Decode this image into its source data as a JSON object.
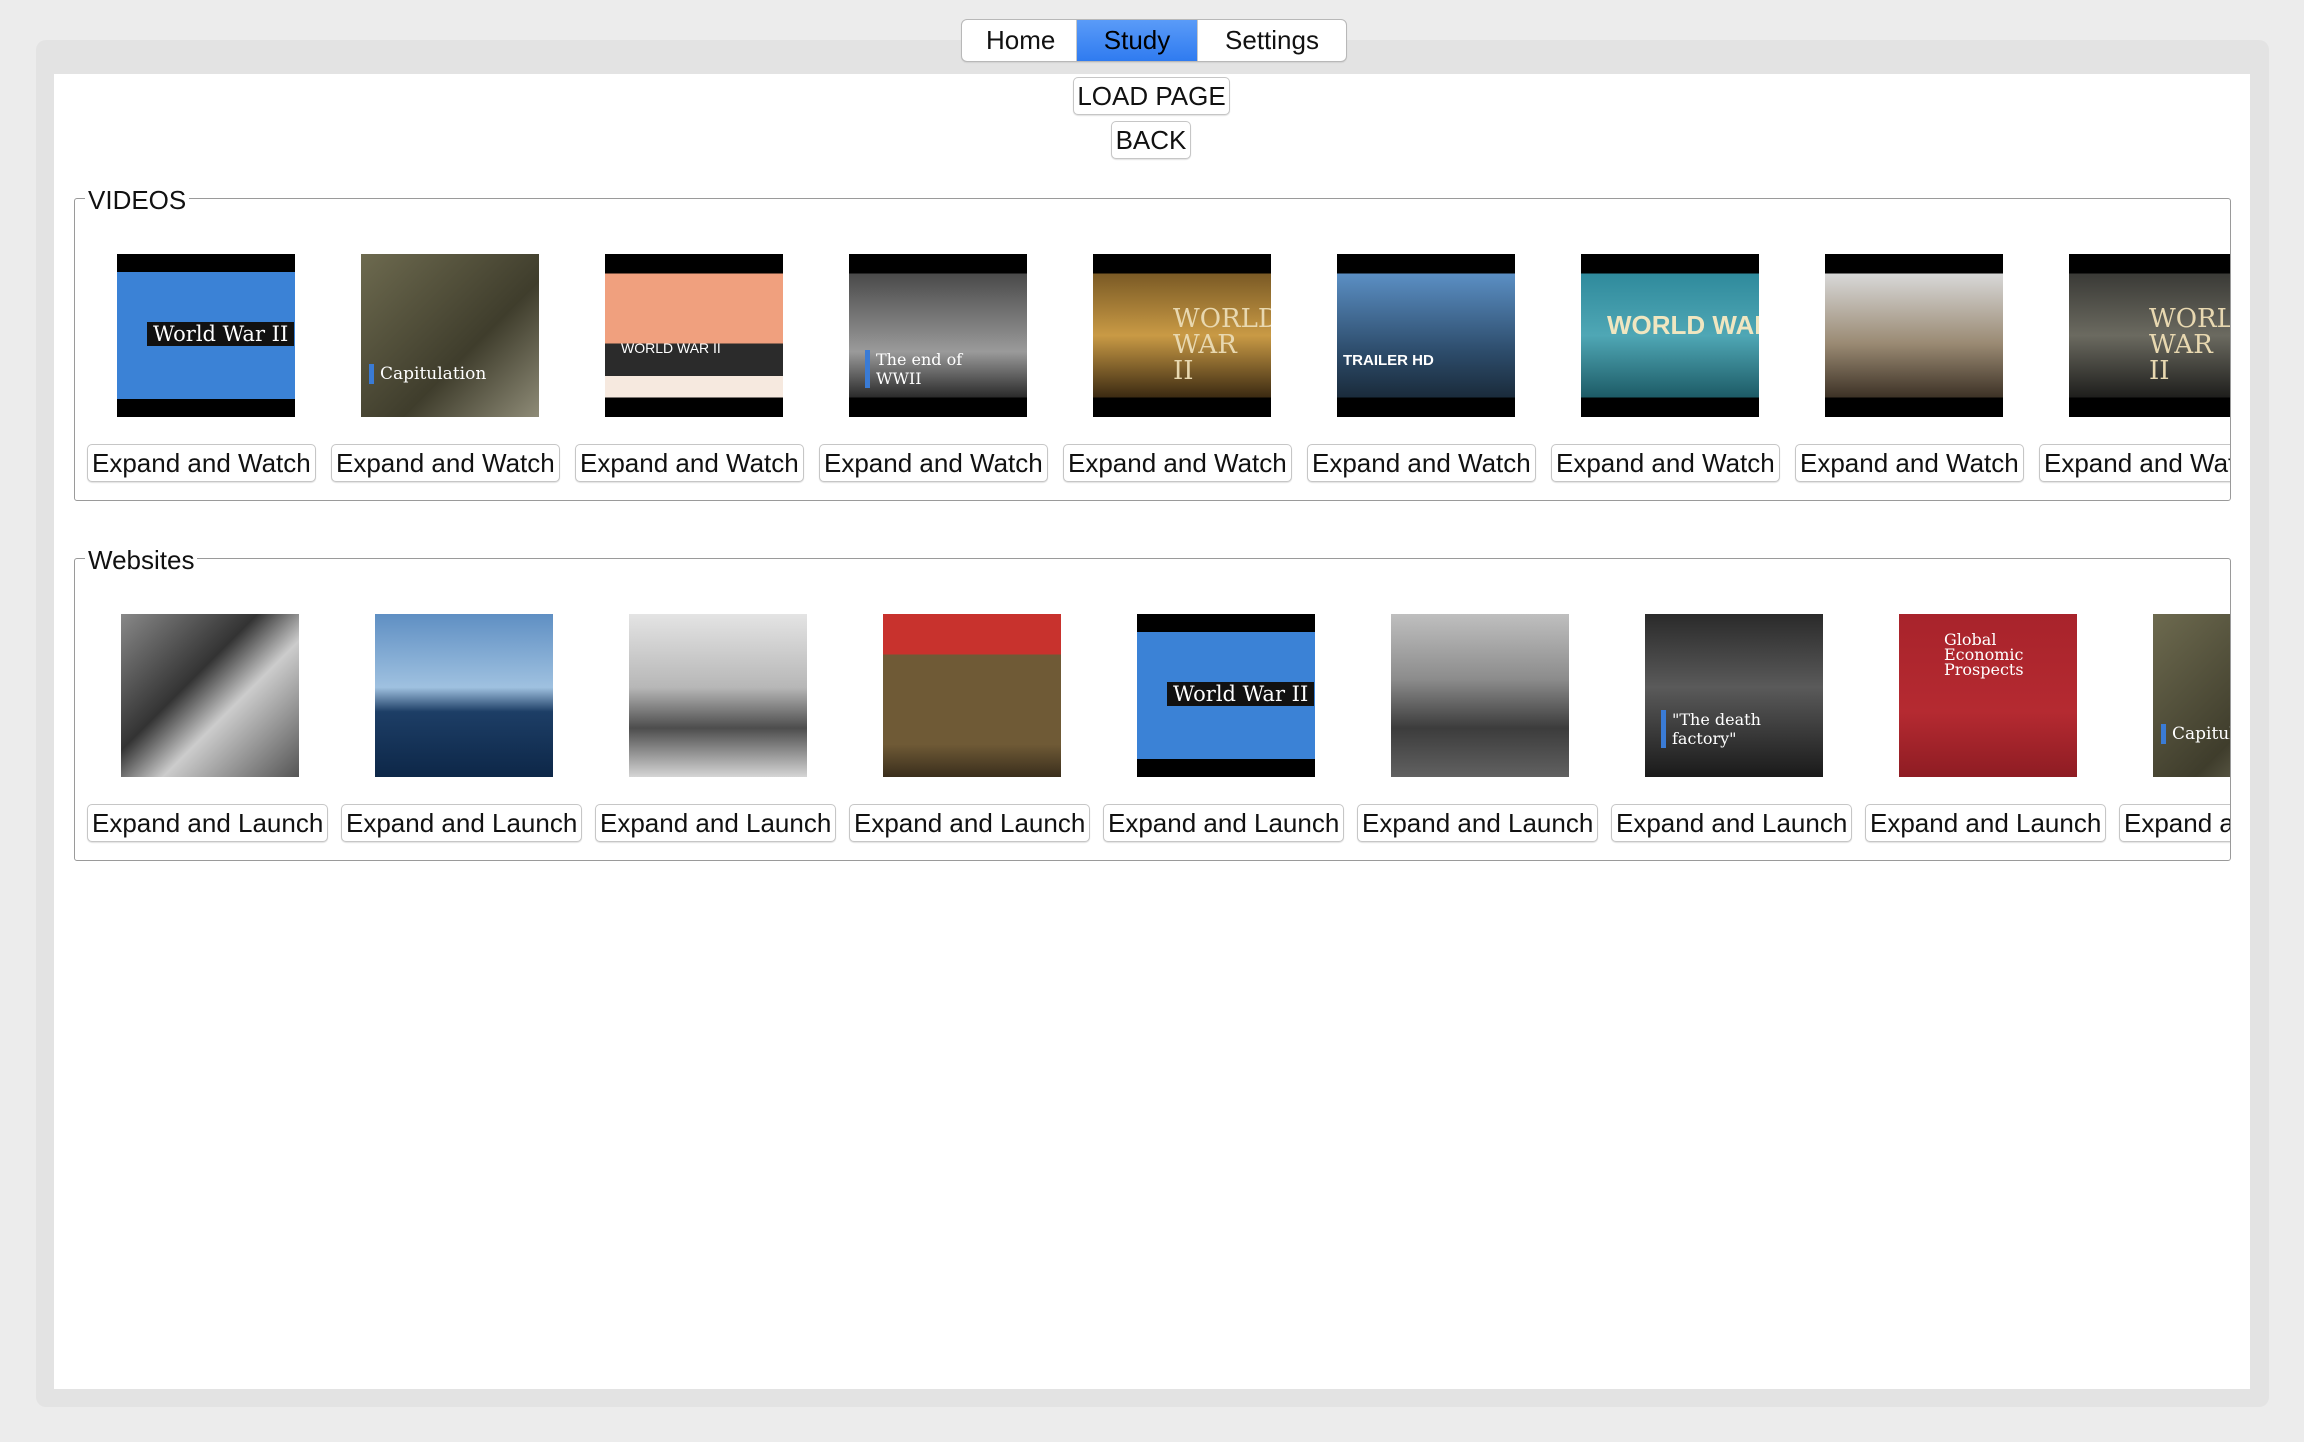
{
  "tabs": [
    {
      "label": "Home",
      "active": false
    },
    {
      "label": "Study",
      "active": true
    },
    {
      "label": "Settings",
      "active": false
    }
  ],
  "actions": {
    "load_label": "LOAD PAGE",
    "back_label": "BACK"
  },
  "videos": {
    "title": "VIDEOS",
    "button_label": "Expand and Watch",
    "items": [
      {
        "caption": "World War II",
        "theme": "map-blue"
      },
      {
        "caption": "Capitulation",
        "theme": "soldiers"
      },
      {
        "caption": "WORLD WAR II",
        "theme": "peach-figures"
      },
      {
        "caption": "The end of WWII",
        "theme": "helmet-bw"
      },
      {
        "caption": "WORLD WAR II",
        "theme": "gold-silhouette"
      },
      {
        "caption": "TRAILER HD",
        "theme": "helmet-color"
      },
      {
        "caption": "WORLD WAR II",
        "theme": "cartoon-teal"
      },
      {
        "caption": "",
        "theme": "salute"
      },
      {
        "caption": "WORLD WAR II",
        "theme": "dark-painting"
      }
    ]
  },
  "websites": {
    "title": "Websites",
    "button_label": "Expand and Launch",
    "items": [
      {
        "caption": "",
        "theme": "collage-bw"
      },
      {
        "caption": "",
        "theme": "plane-sky"
      },
      {
        "caption": "",
        "theme": "tanks-bw"
      },
      {
        "caption": "",
        "theme": "uniforms"
      },
      {
        "caption": "World War II",
        "theme": "map-blue"
      },
      {
        "caption": "",
        "theme": "landing-bw"
      },
      {
        "caption": "\"The death factory\"",
        "theme": "soldier-bw"
      },
      {
        "caption": "Global Economic Prospects",
        "theme": "red-report"
      },
      {
        "caption": "Capitula",
        "theme": "soldiers"
      }
    ]
  }
}
